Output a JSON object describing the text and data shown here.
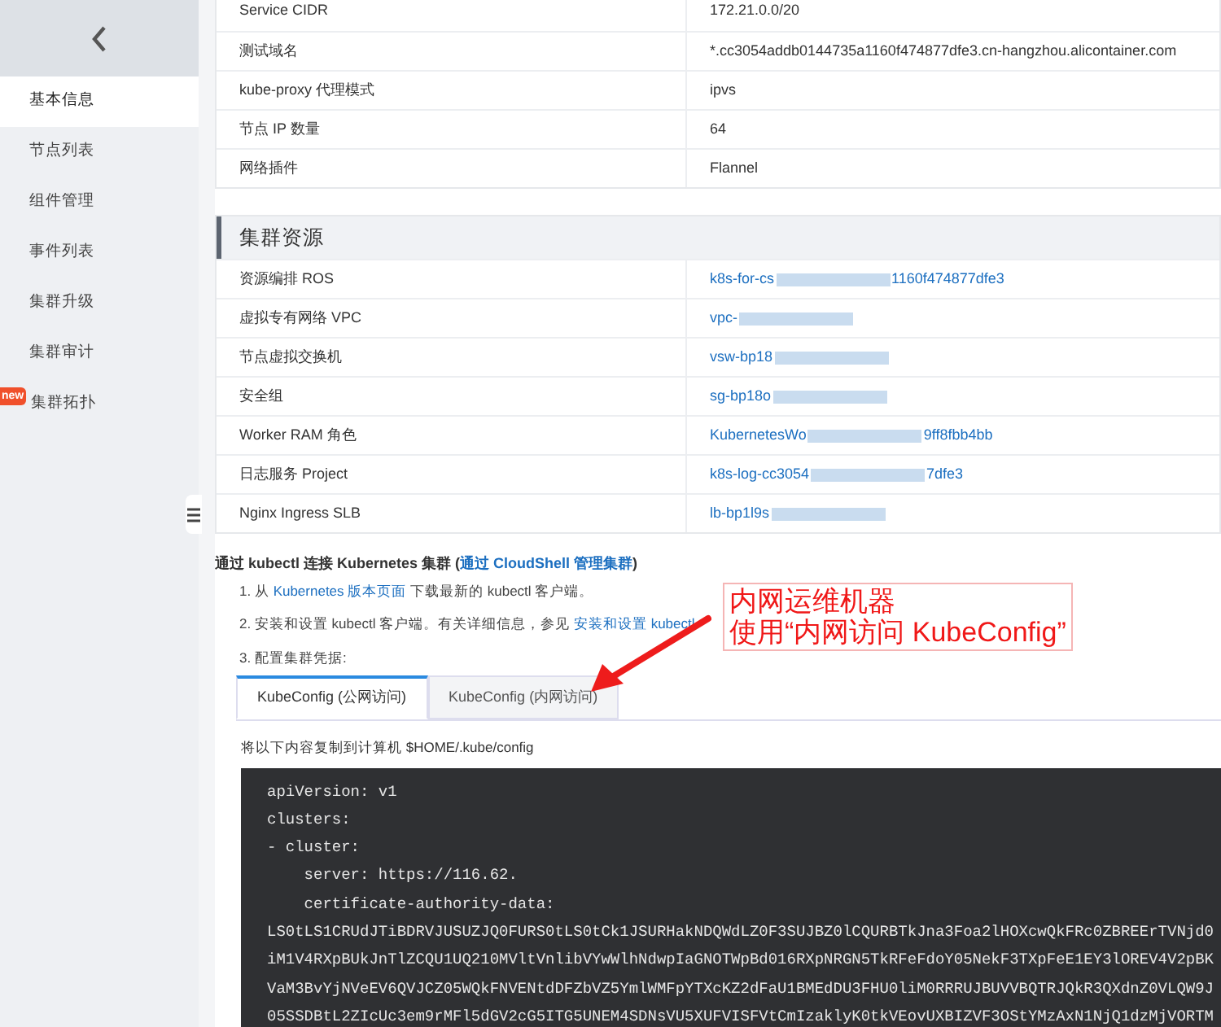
{
  "sidebar": {
    "items": [
      {
        "label": "基本信息",
        "selected": true
      },
      {
        "label": "节点列表",
        "selected": false
      },
      {
        "label": "组件管理",
        "selected": false
      },
      {
        "label": "事件列表",
        "selected": false
      },
      {
        "label": "集群升级",
        "selected": false
      },
      {
        "label": "集群审计",
        "selected": false
      },
      {
        "label": "集群拓扑",
        "selected": false,
        "badge": "new"
      }
    ]
  },
  "info_table": {
    "rows": [
      {
        "label": "Service CIDR",
        "value": "172.21.0.0/20"
      },
      {
        "label": "测试域名",
        "value": "*.cc3054addb0144735a1160f474877dfe3.cn-hangzhou.alicontainer.com"
      },
      {
        "label": "kube-proxy 代理模式",
        "value": "ipvs"
      },
      {
        "label": "节点 IP 数量",
        "value": "64"
      },
      {
        "label": "网络插件",
        "value": "Flannel"
      }
    ]
  },
  "resources": {
    "title": "集群资源",
    "rows": [
      {
        "label": "资源编排 ROS",
        "value": "k8s-for-cs",
        "tail": "1160f474877dfe3"
      },
      {
        "label": "虚拟专有网络 VPC",
        "value": "vpc-"
      },
      {
        "label": "节点虚拟交换机",
        "value": "vsw-bp18"
      },
      {
        "label": "安全组",
        "value": "sg-bp18o"
      },
      {
        "label": "Worker RAM 角色",
        "value": "KubernetesWo",
        "tail": "9ff8fbb4bb"
      },
      {
        "label": "日志服务 Project",
        "value": "k8s-log-cc3054",
        "tail": "7dfe3"
      },
      {
        "label": "Nginx Ingress SLB",
        "value": "lb-bp1l9s"
      }
    ]
  },
  "kubectl": {
    "heading": "通过 kubectl 连接 Kubernetes 集群 (",
    "heading_link": "通过 CloudShell 管理集群",
    "heading_end": ")",
    "steps": [
      {
        "before": "1. 从 ",
        "link": "Kubernetes 版本页面",
        "after": " 下载最新的 kubectl 客户端。"
      },
      {
        "before": "2. 安装和设置 kubectl 客户端。有关详细信息，参见 ",
        "link": "安装和设置 kubectl"
      },
      {
        "before": "3. 配置集群凭据:"
      }
    ],
    "tabs": [
      {
        "label": "KubeConfig (公网访问)",
        "selected": true
      },
      {
        "label": "KubeConfig (内网访问)",
        "selected": false
      }
    ],
    "instruction": "将以下内容复制到计算机 $HOME/.kube/config",
    "code_lines": [
      "apiVersion: v1",
      "clusters:",
      "- cluster:",
      "    server: https://116.62.",
      "    certificate-authority-data:",
      "LS0tLS1CRUdJTiBDRVJUSUZJQ0FURS0tLS0tCk1JSURHakNDQWdLZ0F3SUJBZ0lCQURBTkJna3Foa2lHOXcwQkFRc0ZBREErTVNjd0",
      "iM1V4RXpBUkJnTlZCQU1UQ210MVltVnlibVYwWlhNdwpIaGNOTWpBd016RXpNRGN5TkRFeFdoY05NekF3TXpFeE1EY3lOREV4V2pBK",
      "VaM3BvYjNVeEV6QVJCZ05WQkFNVENtdDFZbVZ5YmlWMFpYTXcKZ2dFaU1BMEdDU3FHU0liM0RRRUJBUVVBQTRJQkR3QXdnZ0VLQW9J",
      "05SSDBtL2ZIcUc3em9rMFl5dGV2cG5ITG5UNEM4SDNsVU5XUFVISFVtCmIzaklyK0tkVEovUXBIZVF3OStYMzAxN1NjQ1dzMjVORTM"
    ]
  },
  "annotation": {
    "lines": [
      "内网运维机器",
      "使用“内网访问 KubeConfig”"
    ]
  }
}
